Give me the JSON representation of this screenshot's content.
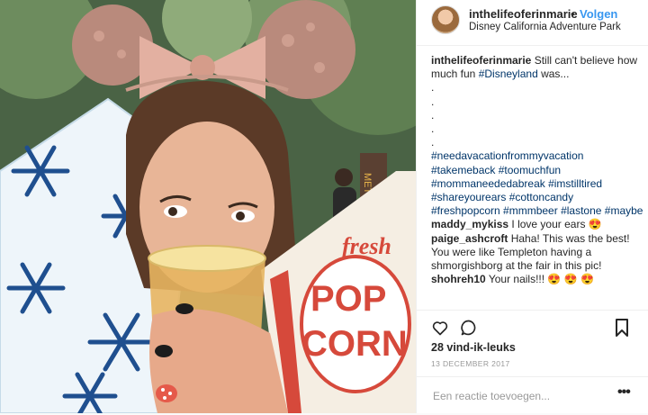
{
  "photo": {
    "description_icon": "photo",
    "popcorn_box_text": [
      "fresh",
      "POP",
      "CORN"
    ],
    "sign_text": "MET"
  },
  "header": {
    "username": "inthelifeoferinmarie",
    "separator": "•",
    "follow_label": "Volgen",
    "location": "Disney California Adventure Park"
  },
  "caption": {
    "username": "inthelifeoferinmarie",
    "text_before_tag": "Still can't believe how much fun",
    "tag": "#Disneyland",
    "text_after_tag": "was...",
    "dots": [
      ".",
      ".",
      ".",
      ".",
      "."
    ],
    "hashtag_lines": [
      "#needavacationfrommyvacation",
      "#takemeback #toomuchfun",
      "#mommaneededabreak #imstilltired",
      "#shareyourears #cottoncandy",
      "#freshpopcorn #mmmbeer #lastone #maybe"
    ]
  },
  "comments": [
    {
      "username": "maddy_mykiss",
      "text": "I love your ears 😍"
    },
    {
      "username": "paige_ashcroft",
      "text": "Haha! This was the best! You were like Templeton having a shmorgishborg at the fair in this pic!"
    },
    {
      "username": "shohreh10",
      "text": "Your nails!!! 😍 😍 😍"
    }
  ],
  "actions": {
    "like_icon": "heart-icon",
    "comment_icon": "speech-bubble-icon",
    "save_icon": "bookmark-icon",
    "likes": "28 vind-ik-leuks",
    "date": "13 DECEMBER 2017"
  },
  "add_comment": {
    "placeholder": "Een reactie toevoegen...",
    "more_label": "•••"
  },
  "colors": {
    "link_blue": "#3897f0",
    "hashtag": "#003569",
    "muted": "#999999"
  }
}
